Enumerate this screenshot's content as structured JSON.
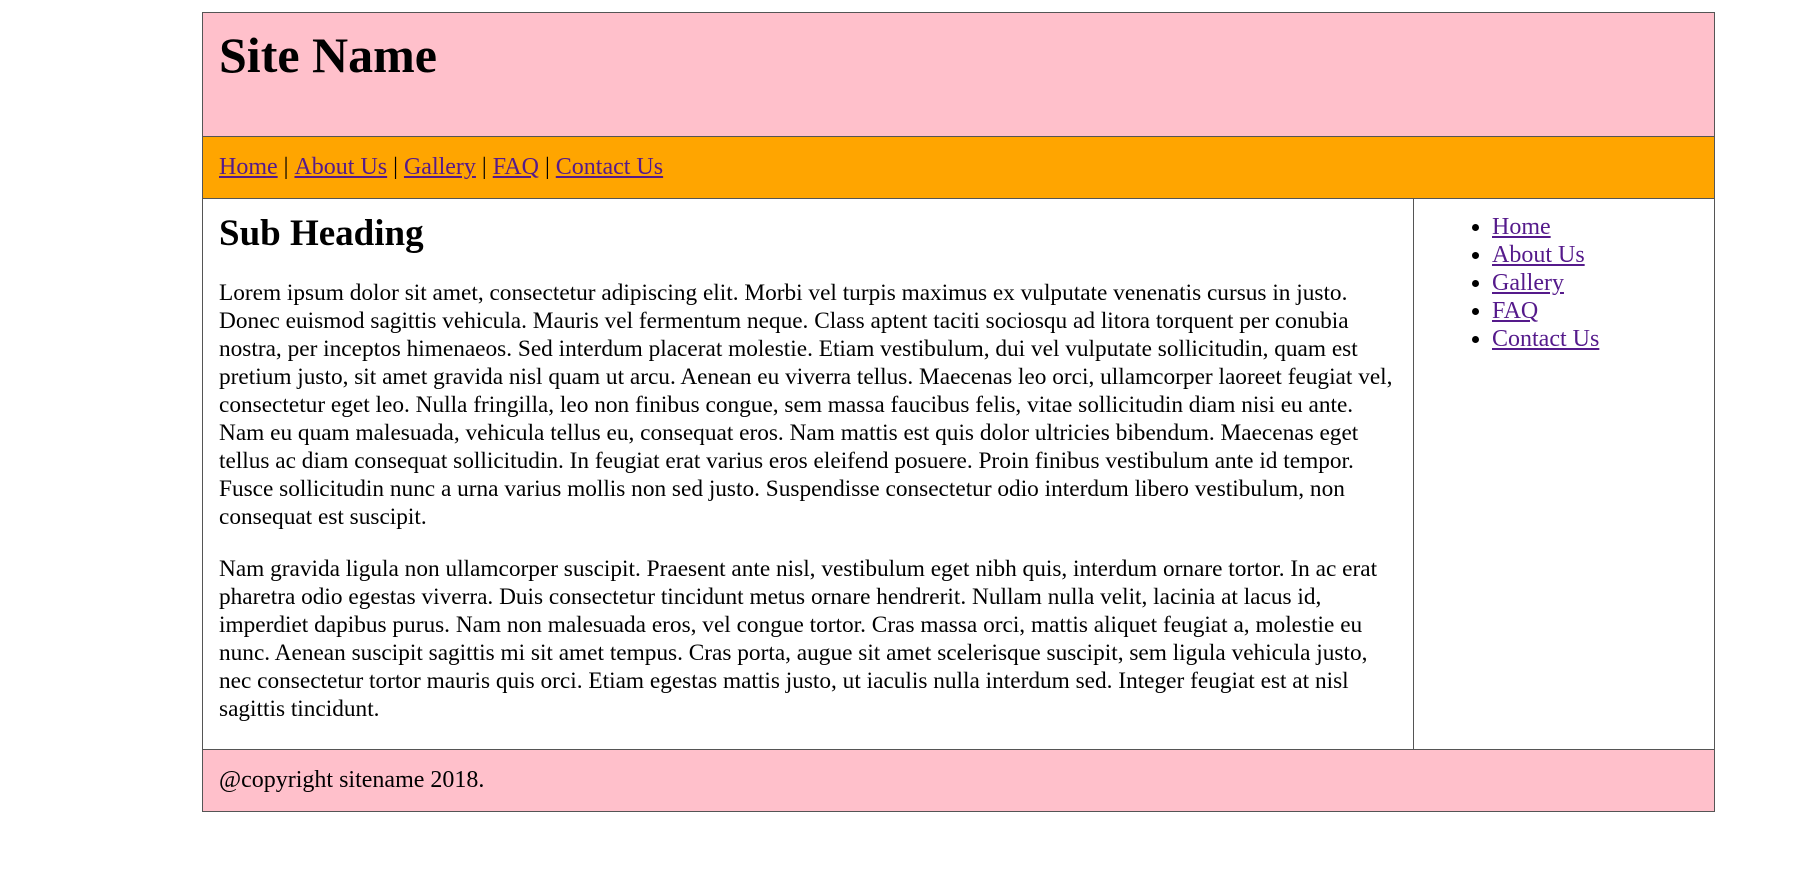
{
  "header": {
    "site_name": "Site Name"
  },
  "nav": {
    "links": [
      "Home",
      "About Us",
      "Gallery",
      "FAQ",
      "Contact Us"
    ],
    "separator": "|"
  },
  "main": {
    "sub_heading": "Sub Heading",
    "paragraphs": [
      "Lorem ipsum dolor sit amet, consectetur adipiscing elit. Morbi vel turpis maximus ex vulputate venenatis cursus in justo. Donec euismod sagittis vehicula. Mauris vel fermentum neque. Class aptent taciti sociosqu ad litora torquent per conubia nostra, per inceptos himenaeos. Sed interdum placerat molestie. Etiam vestibulum, dui vel vulputate sollicitudin, quam est pretium justo, sit amet gravida nisl quam ut arcu. Aenean eu viverra tellus. Maecenas leo orci, ullamcorper laoreet feugiat vel, consectetur eget leo. Nulla fringilla, leo non finibus congue, sem massa faucibus felis, vitae sollicitudin diam nisi eu ante. Nam eu quam malesuada, vehicula tellus eu, consequat eros. Nam mattis est quis dolor ultricies bibendum. Maecenas eget tellus ac diam consequat sollicitudin. In feugiat erat varius eros eleifend posuere. Proin finibus vestibulum ante id tempor. Fusce sollicitudin nunc a urna varius mollis non sed justo. Suspendisse consectetur odio interdum libero vestibulum, non consequat est suscipit.",
      "Nam gravida ligula non ullamcorper suscipit. Praesent ante nisl, vestibulum eget nibh quis, interdum ornare tortor. In ac erat pharetra odio egestas viverra. Duis consectetur tincidunt metus ornare hendrerit. Nullam nulla velit, lacinia at lacus id, imperdiet dapibus purus. Nam non malesuada eros, vel congue tortor. Cras massa orci, mattis aliquet feugiat a, molestie eu nunc. Aenean suscipit sagittis mi sit amet tempus. Cras porta, augue sit amet scelerisque suscipit, sem ligula vehicula justo, nec consectetur tortor mauris quis orci. Etiam egestas mattis justo, ut iaculis nulla interdum sed. Integer feugiat est at nisl sagittis tincidunt."
    ]
  },
  "sidebar": {
    "links": [
      "Home",
      "About Us",
      "Gallery",
      "FAQ",
      "Contact Us"
    ]
  },
  "footer": {
    "copyright": "@copyright sitename 2018."
  },
  "colors": {
    "header_bg": "#ffc0cb",
    "nav_bg": "#ffa500",
    "footer_bg": "#ffc0cb",
    "link": "#551a8b",
    "border": "#555555"
  }
}
